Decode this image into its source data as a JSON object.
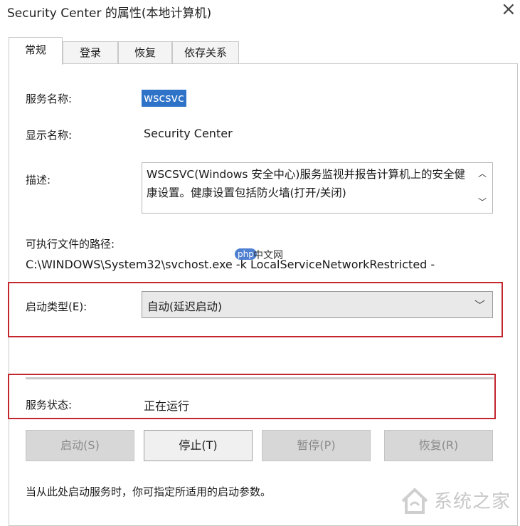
{
  "window": {
    "title": "Security Center 的属性(本地计算机)",
    "close_glyph": "×"
  },
  "tabs": [
    {
      "label": "常规",
      "active": true
    },
    {
      "label": "登录",
      "active": false
    },
    {
      "label": "恢复",
      "active": false
    },
    {
      "label": "依存关系",
      "active": false
    }
  ],
  "general": {
    "service_name_label": "服务名称:",
    "service_name_value": "wscsvc",
    "display_name_label": "显示名称:",
    "display_name_value": "Security Center",
    "description_label": "描述:",
    "description_text": "WSCSVC(Windows 安全中心)服务监视并报告计算机上的安全健康设置。健康设置包括防火墙(打开/关闭)",
    "exe_path_label": "可执行文件的路径:",
    "exe_path_value": "C:\\WINDOWS\\System32\\svchost.exe -k LocalServiceNetworkRestricted -",
    "startup_type_label": "启动类型(E):",
    "startup_type_value": "自动(延迟启动)",
    "service_status_label": "服务状态:",
    "service_status_value": "正在运行",
    "hint_text": "当从此处启动服务时，你可指定所适用的启动参数。"
  },
  "buttons": {
    "start": {
      "label": "启动(S)",
      "enabled": false
    },
    "stop": {
      "label": "停止(T)",
      "enabled": true
    },
    "pause": {
      "label": "暂停(P)",
      "enabled": false
    },
    "resume": {
      "label": "恢复(R)",
      "enabled": false
    }
  },
  "watermarks": {
    "php_badge": "php",
    "php_text": "中文网",
    "site_text": "系统之家"
  },
  "colors": {
    "highlight": "#2f73c8",
    "annotation_red": "#c4262e"
  }
}
